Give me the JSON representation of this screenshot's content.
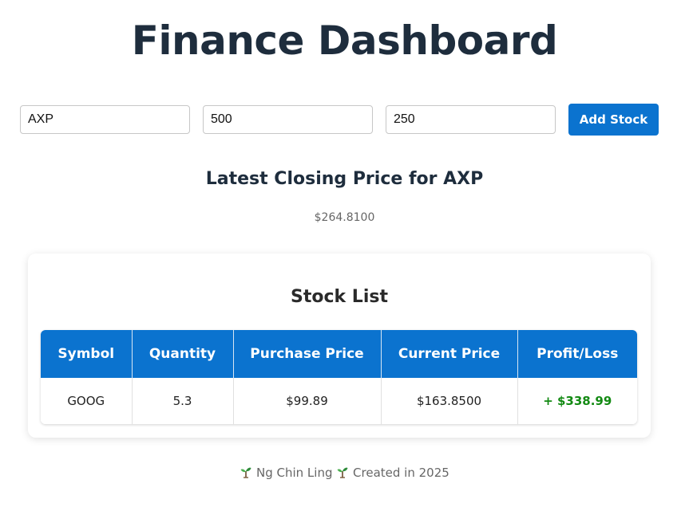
{
  "header": {
    "title": "Finance Dashboard"
  },
  "form": {
    "symbol_value": "AXP",
    "quantity_value": "500",
    "price_value": "250",
    "add_button_label": "Add Stock"
  },
  "closing": {
    "heading": "Latest Closing Price for AXP",
    "value": "$264.8100"
  },
  "stock_list": {
    "title": "Stock List",
    "columns": [
      "Symbol",
      "Quantity",
      "Purchase Price",
      "Current Price",
      "Profit/Loss"
    ],
    "rows": [
      {
        "symbol": "GOOG",
        "quantity": "5.3",
        "purchase_price": "$99.89",
        "current_price": "$163.8500",
        "profit_loss": "+ $338.99"
      }
    ]
  },
  "footer": {
    "name": "Ng Chin Ling",
    "created": "Created in 2025",
    "icon": "seedling-icon"
  },
  "colors": {
    "accent": "#0b73cf",
    "title": "#1e2d3d",
    "profit": "#138a13"
  }
}
